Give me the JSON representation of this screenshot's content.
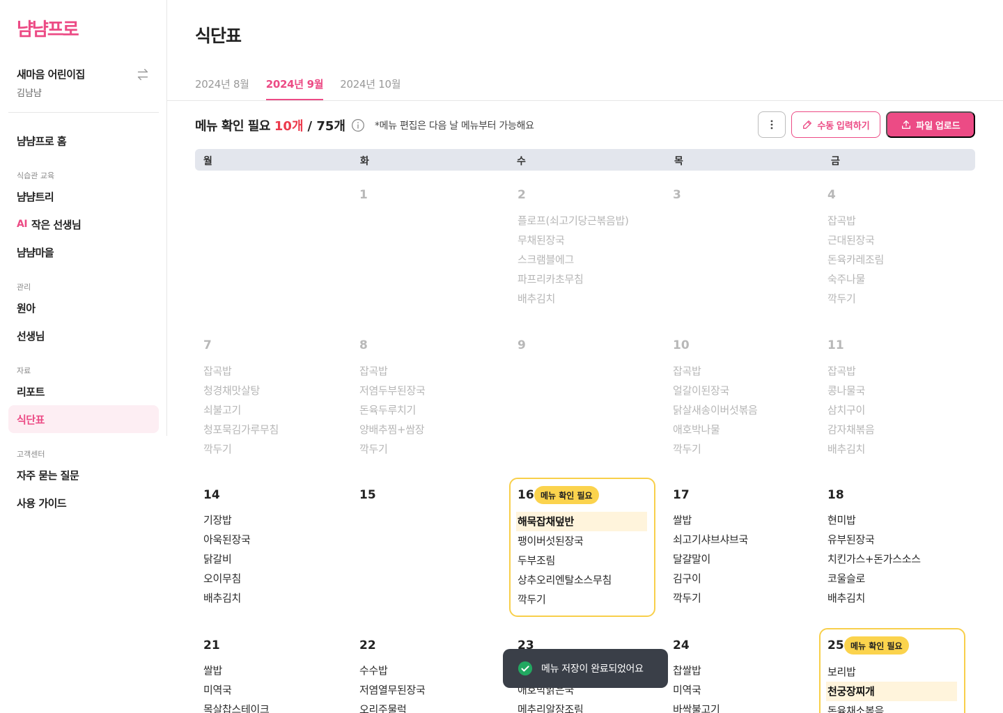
{
  "brand": {
    "logo_text": "냠냠프로",
    "accent": "#ec4b85"
  },
  "sidebar": {
    "org_name": "새마음 어린이집",
    "user_name": "김냠냠",
    "swap_icon": "swap-icon",
    "home": "냠냠프로 홈",
    "sections": {
      "education": "식습관 교육",
      "management": "관리",
      "resources": "자료",
      "support": "고객센터"
    },
    "items": {
      "tree": "냠냠트리",
      "ai_prefix": "AI",
      "ai_teacher": "작은 선생님",
      "village": "냠냠마을",
      "kids": "원아",
      "teachers": "선생님",
      "report": "리포트",
      "menu_table": "식단표",
      "faq": "자주 묻는 질문",
      "guide": "사용 가이드"
    }
  },
  "page": {
    "title": "식단표",
    "tabs": [
      "2024년 8월",
      "2024년 9월",
      "2024년 10월"
    ],
    "active_tab": "2024년 9월",
    "summary_label": "메뉴 확인 필요",
    "summary_count": "10개",
    "summary_total": "/ 75개",
    "summary_note": "*메뉴 편집은 다음 날 메뉴부터 가능해요",
    "buttons": {
      "more": "more-vertical-icon",
      "manual": "수동 입력하기",
      "upload": "파일 업로드"
    }
  },
  "calendar": {
    "weekdays": [
      "월",
      "화",
      "수",
      "목",
      "금"
    ],
    "badge_label": "메뉴 확인 필요",
    "weeks": [
      [
        {
          "day": "",
          "menu": []
        },
        {
          "day": "1",
          "menu": []
        },
        {
          "day": "2",
          "menu": [
            "플로프(쇠고기당근볶음밥)",
            "무채된장국",
            "스크램블에그",
            "파프리카초무침",
            "배추김치"
          ]
        },
        {
          "day": "3",
          "menu": []
        },
        {
          "day": "4",
          "menu": [
            "잡곡밥",
            "근대된장국",
            "돈육카레조림",
            "숙주나물",
            "깍두기"
          ]
        }
      ],
      [
        {
          "day": "7",
          "menu": [
            "잡곡밥",
            "청경채맛살탕",
            "쇠불고기",
            "청포묵김가루무침",
            "깍두기"
          ]
        },
        {
          "day": "8",
          "menu": [
            "잡곡밥",
            "저염두부된장국",
            "돈육두루치기",
            "양배추찜+쌈장",
            "깍두기"
          ]
        },
        {
          "day": "9",
          "menu": []
        },
        {
          "day": "10",
          "menu": [
            "잡곡밥",
            "얼갈이된장국",
            "닭살새송이버섯볶음",
            "애호박나물",
            "깍두기"
          ]
        },
        {
          "day": "11",
          "menu": [
            "잡곡밥",
            "콩나물국",
            "삼치구이",
            "감자채볶음",
            "배추김치"
          ]
        }
      ],
      [
        {
          "day": "14",
          "menu": [
            "기장밥",
            "아욱된장국",
            "닭갈비",
            "오이무침",
            "배추김치"
          ]
        },
        {
          "day": "15",
          "menu": []
        },
        {
          "day": "16",
          "flag": true,
          "highlight": 0,
          "menu": [
            "해묵잡채덮반",
            "팽이버섯된장국",
            "두부조림",
            "상추오리엔탈소스무침",
            "깍두기"
          ]
        },
        {
          "day": "17",
          "menu": [
            "쌀밥",
            "쇠고기샤브샤브국",
            "달걀말이",
            "김구이",
            "깍두기"
          ]
        },
        {
          "day": "18",
          "menu": [
            "현미밥",
            "유부된장국",
            "치킨가스+돈가스소스",
            "코울슬로",
            "배추김치"
          ]
        }
      ],
      [
        {
          "day": "21",
          "menu": [
            "쌀밥",
            "미역국",
            "목살찹스테이크"
          ]
        },
        {
          "day": "22",
          "menu": [
            "수수밥",
            "저염열무된장국",
            "오리주물럭"
          ]
        },
        {
          "day": "23",
          "menu": [
            "",
            "애호박맑은국",
            "메추리알장조림"
          ]
        },
        {
          "day": "24",
          "menu": [
            "찹쌀밥",
            "미역국",
            "바싹불고기"
          ]
        },
        {
          "day": "25",
          "flag": true,
          "highlight": 1,
          "menu": [
            "보리밥",
            "천궁장찌개",
            "돈육채소볶음"
          ]
        }
      ]
    ]
  },
  "toast": {
    "message": "메뉴 저장이 완료되었어요",
    "icon": "check-circle-icon",
    "color": "#22a861"
  }
}
